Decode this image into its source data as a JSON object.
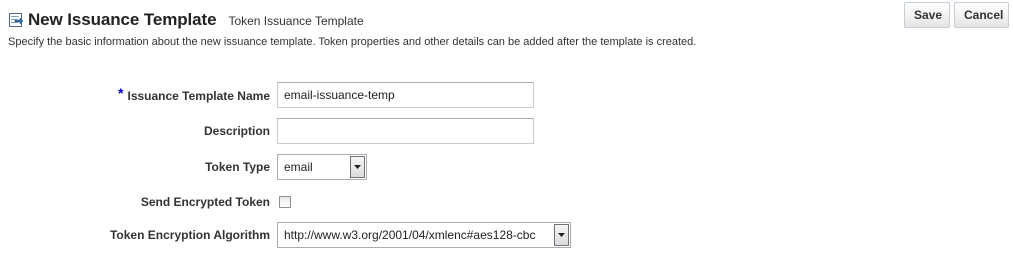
{
  "header": {
    "title": "New Issuance Template",
    "subtitle": "Token Issuance Template",
    "icon": "template-icon"
  },
  "description": "Specify the basic information about the new issuance template. Token properties and other details can be added after the template is created.",
  "toolbar": {
    "save_label": "Save",
    "cancel_label": "Cancel"
  },
  "form": {
    "required_marker": "*",
    "template_name": {
      "label": "Issuance Template Name",
      "value": "email-issuance-temp",
      "required": true
    },
    "description": {
      "label": "Description",
      "value": ""
    },
    "token_type": {
      "label": "Token Type",
      "value": "email"
    },
    "send_encrypted": {
      "label": "Send Encrypted Token",
      "checked": false
    },
    "encryption_algorithm": {
      "label": "Token Encryption Algorithm",
      "value": "http://www.w3.org/2001/04/xmlenc#aes128-cbc"
    }
  },
  "colors": {
    "required_star": "#0000cc",
    "text": "#333333",
    "border": "#c7cdd2"
  }
}
